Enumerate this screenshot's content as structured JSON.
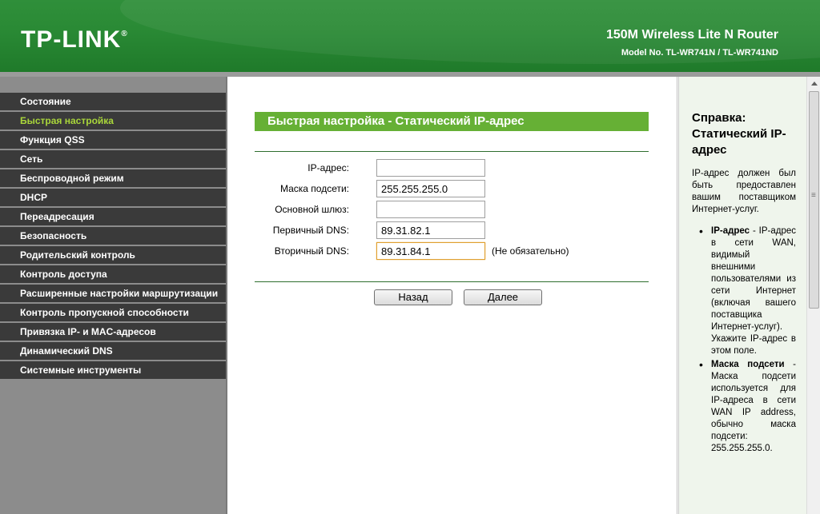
{
  "header": {
    "logo": "TP-LINK",
    "logo_mark": "®",
    "product": "150M Wireless Lite N Router",
    "model": "Model No. TL-WR741N / TL-WR741ND"
  },
  "sidebar": {
    "items": [
      {
        "label": "Состояние"
      },
      {
        "label": "Быстрая настройка",
        "active": true
      },
      {
        "label": "Функция QSS"
      },
      {
        "label": "Сеть"
      },
      {
        "label": "Беспроводной режим"
      },
      {
        "label": "DHCP"
      },
      {
        "label": "Переадресация"
      },
      {
        "label": "Безопасность"
      },
      {
        "label": "Родительский контроль"
      },
      {
        "label": "Контроль доступа"
      },
      {
        "label": "Расширенные настройки маршрутизации"
      },
      {
        "label": "Контроль пропускной способности"
      },
      {
        "label": "Привязка IP- и MAC-адресов"
      },
      {
        "label": "Динамический DNS"
      },
      {
        "label": "Системные инструменты"
      }
    ]
  },
  "main": {
    "title": "Быстрая настройка - Статический IP-адрес",
    "fields": [
      {
        "label": "IP-адрес:",
        "value": ""
      },
      {
        "label": "Маска подсети:",
        "value": "255.255.255.0"
      },
      {
        "label": "Основной шлюз:",
        "value": ""
      },
      {
        "label": "Первичный DNS:",
        "value": "89.31.82.1"
      },
      {
        "label": "Вторичный DNS:",
        "value": "89.31.84.1",
        "note": "(Не обязательно)"
      }
    ],
    "back_label": "Назад",
    "next_label": "Далее"
  },
  "help": {
    "title": "Справка: Статический IP-адрес",
    "intro": "IP-адрес должен был быть предоставлен вашим поставщиком Интернет-услуг.",
    "items": [
      {
        "term": "IP-адрес",
        "text": " - IP-адрес в сети WAN, видимый внешними пользователями из сети Интернет (включая вашего поставщика Интернет-услуг). Укажите IP-адрес в этом поле."
      },
      {
        "term": "Маска подсети",
        "text": " - Маска подсети используется для IP-адреса в сети WAN IP address, обычно маска подсети: 255.255.255.0."
      }
    ]
  },
  "colors": {
    "header_green": "#2a8a35",
    "title_bar_green": "#66b035",
    "menu_active": "#a9d63a",
    "menu_bg": "#3a3a3a",
    "help_bg": "#eff5ec"
  }
}
